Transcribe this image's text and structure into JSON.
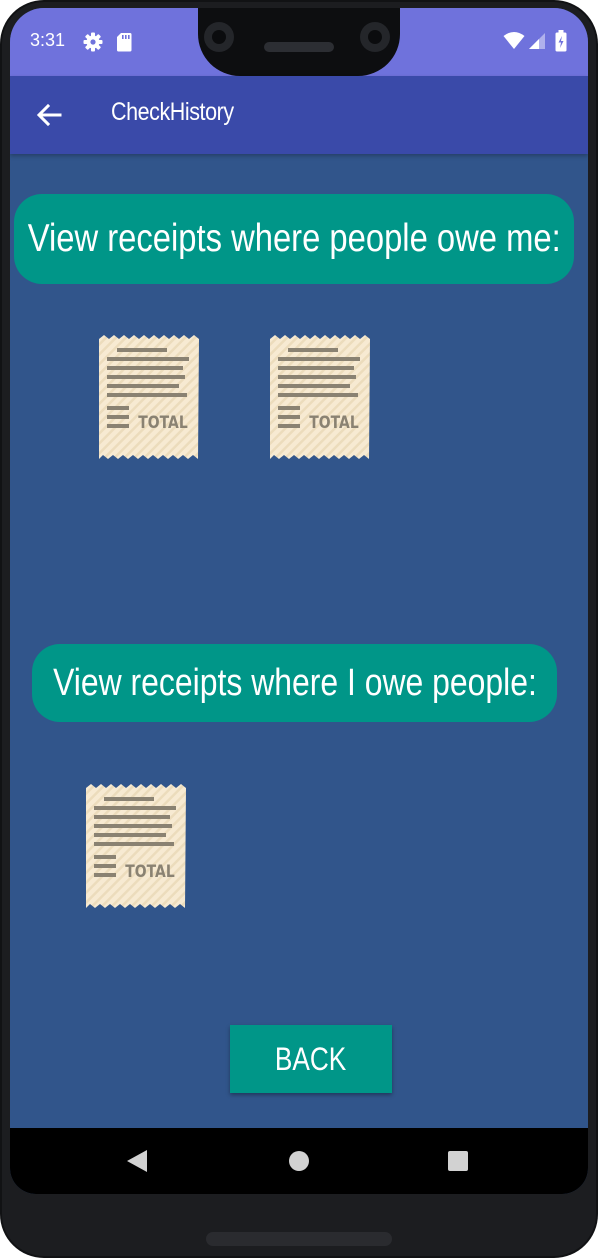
{
  "status_bar": {
    "time": "3:31",
    "icons": [
      "gear-icon",
      "sd-card-icon",
      "wifi-icon",
      "cell-signal-icon",
      "battery-icon"
    ],
    "background_color": "#6f72dc"
  },
  "app_bar": {
    "title": "CheckHistory",
    "back_icon": "back-arrow-icon",
    "background_color": "#3a4aa9"
  },
  "sections": {
    "owed_to_me": {
      "heading": "View receipts where people owe me:",
      "receipts": [
        {
          "label": "TOTAL"
        },
        {
          "label": "TOTAL"
        }
      ]
    },
    "i_owe": {
      "heading": "View receipts where I owe people:",
      "receipts": [
        {
          "label": "TOTAL"
        }
      ]
    }
  },
  "back_button": {
    "label": "BACK"
  },
  "nav_bar": {
    "buttons": [
      "nav-back-icon",
      "nav-home-icon",
      "nav-recents-icon"
    ]
  },
  "colors": {
    "screen_background": "#31558b",
    "accent": "#009688",
    "receipt_paper": "#f7ead2"
  }
}
